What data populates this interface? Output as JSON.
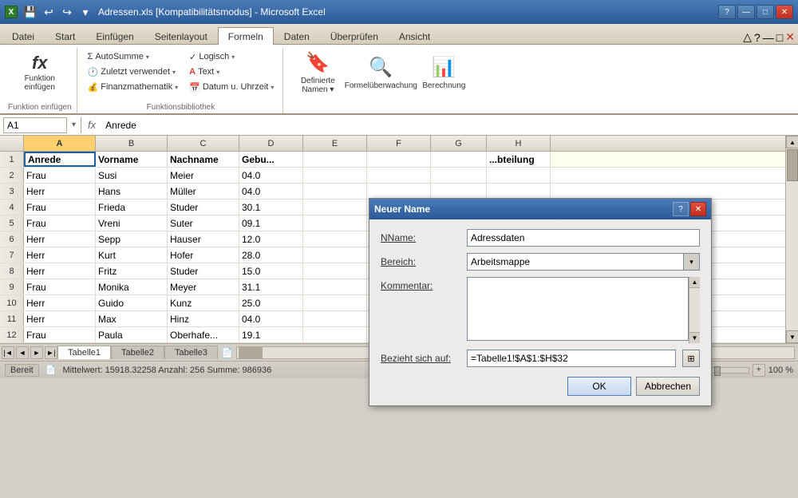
{
  "window": {
    "title": "Adressen.xls [Kompatibilitätsmodus] - Microsoft Excel",
    "icon": "X"
  },
  "titlebar": {
    "quickaccess": [
      "💾",
      "↩",
      "↪"
    ],
    "controls": [
      "—",
      "□",
      "✕"
    ]
  },
  "ribbon": {
    "tabs": [
      "Datei",
      "Start",
      "Einfügen",
      "Seitenlayout",
      "Formeln",
      "Daten",
      "Überprüfen",
      "Ansicht"
    ],
    "active_tab": "Formeln",
    "groups": [
      {
        "label": "Funktion einfügen",
        "items": [
          {
            "type": "large",
            "icon": "𝑓ₓ",
            "label": "Funktion\neinfügen"
          }
        ]
      },
      {
        "label": "Funktionsbibliothek",
        "items": [
          {
            "type": "small",
            "icon": "Σ",
            "label": "AutoSumme ▾"
          },
          {
            "type": "small",
            "icon": "🕐",
            "label": "Zuletzt verwendet ▾"
          },
          {
            "type": "small",
            "icon": "💰",
            "label": "Finanzmathematik ▾"
          },
          {
            "type": "small",
            "icon": "✓",
            "label": "Logisch ▾"
          },
          {
            "type": "small",
            "icon": "A",
            "label": "Text ▾"
          },
          {
            "type": "small",
            "icon": "📅",
            "label": "Datum u. Uhrzeit ▾"
          }
        ]
      },
      {
        "label": "",
        "items": [
          {
            "type": "large",
            "icon": "🔖",
            "label": "Definierte\nNamen ▾"
          },
          {
            "type": "large",
            "icon": "🔍",
            "label": "Formelüberwachung"
          },
          {
            "type": "large",
            "icon": "📊",
            "label": "Berechnung"
          }
        ]
      }
    ]
  },
  "formula_bar": {
    "name_box": "A1",
    "formula": "Anrede"
  },
  "columns": [
    "A",
    "B",
    "C",
    "D",
    "E",
    "F",
    "G",
    "H"
  ],
  "rows": [
    {
      "num": "1",
      "cells": [
        "Anrede",
        "Vorname",
        "Nachname",
        "Gebu...",
        "",
        "",
        "",
        "...bteilung"
      ]
    },
    {
      "num": "2",
      "cells": [
        "Frau",
        "Susi",
        "Meier",
        "04.0",
        "",
        "",
        "",
        ""
      ]
    },
    {
      "num": "3",
      "cells": [
        "Herr",
        "Hans",
        "Müller",
        "04.0",
        "",
        "",
        "",
        ""
      ]
    },
    {
      "num": "4",
      "cells": [
        "Frau",
        "Frieda",
        "Studer",
        "30.1",
        "",
        "",
        "",
        ""
      ]
    },
    {
      "num": "5",
      "cells": [
        "Frau",
        "Vreni",
        "Suter",
        "09.1",
        "",
        "",
        "",
        ""
      ]
    },
    {
      "num": "6",
      "cells": [
        "Herr",
        "Sepp",
        "Hauser",
        "12.0",
        "",
        "",
        "",
        ""
      ]
    },
    {
      "num": "7",
      "cells": [
        "Herr",
        "Kurt",
        "Hofer",
        "28.0",
        "",
        "",
        "",
        ""
      ]
    },
    {
      "num": "8",
      "cells": [
        "Herr",
        "Fritz",
        "Studer",
        "15.0",
        "",
        "",
        "",
        ""
      ]
    },
    {
      "num": "9",
      "cells": [
        "Frau",
        "Monika",
        "Meyer",
        "31.1",
        "",
        "",
        "",
        ""
      ]
    },
    {
      "num": "10",
      "cells": [
        "Herr",
        "Guido",
        "Kunz",
        "25.0",
        "",
        "",
        "",
        ""
      ]
    },
    {
      "num": "11",
      "cells": [
        "Herr",
        "Max",
        "Hinz",
        "04.0",
        "",
        "",
        "",
        ""
      ]
    },
    {
      "num": "12",
      "cells": [
        "Frau",
        "Paula",
        "Oberhafe...",
        "19.1",
        "",
        "",
        "",
        ""
      ]
    }
  ],
  "sheet_tabs": [
    "Tabelle1",
    "Tabelle2",
    "Tabelle3"
  ],
  "active_sheet": "Tabelle1",
  "status_bar": {
    "ready": "Bereit",
    "stats": "Mittelwert: 15918.32258    Anzahl: 256    Summe: 986936",
    "zoom": "100 %"
  },
  "dialog": {
    "title": "Neuer Name",
    "fields": {
      "name_label": "Name:",
      "name_value": "Adressdaten",
      "bereich_label": "Bereich:",
      "bereich_value": "Arbeitsmappe",
      "kommentar_label": "Kommentar:",
      "kommentar_value": "",
      "bezieht_label": "Bezieht sich auf:",
      "bezieht_value": "=Tabelle1!$A$1:$H$32"
    },
    "buttons": {
      "ok": "OK",
      "cancel": "Abbrechen"
    }
  }
}
